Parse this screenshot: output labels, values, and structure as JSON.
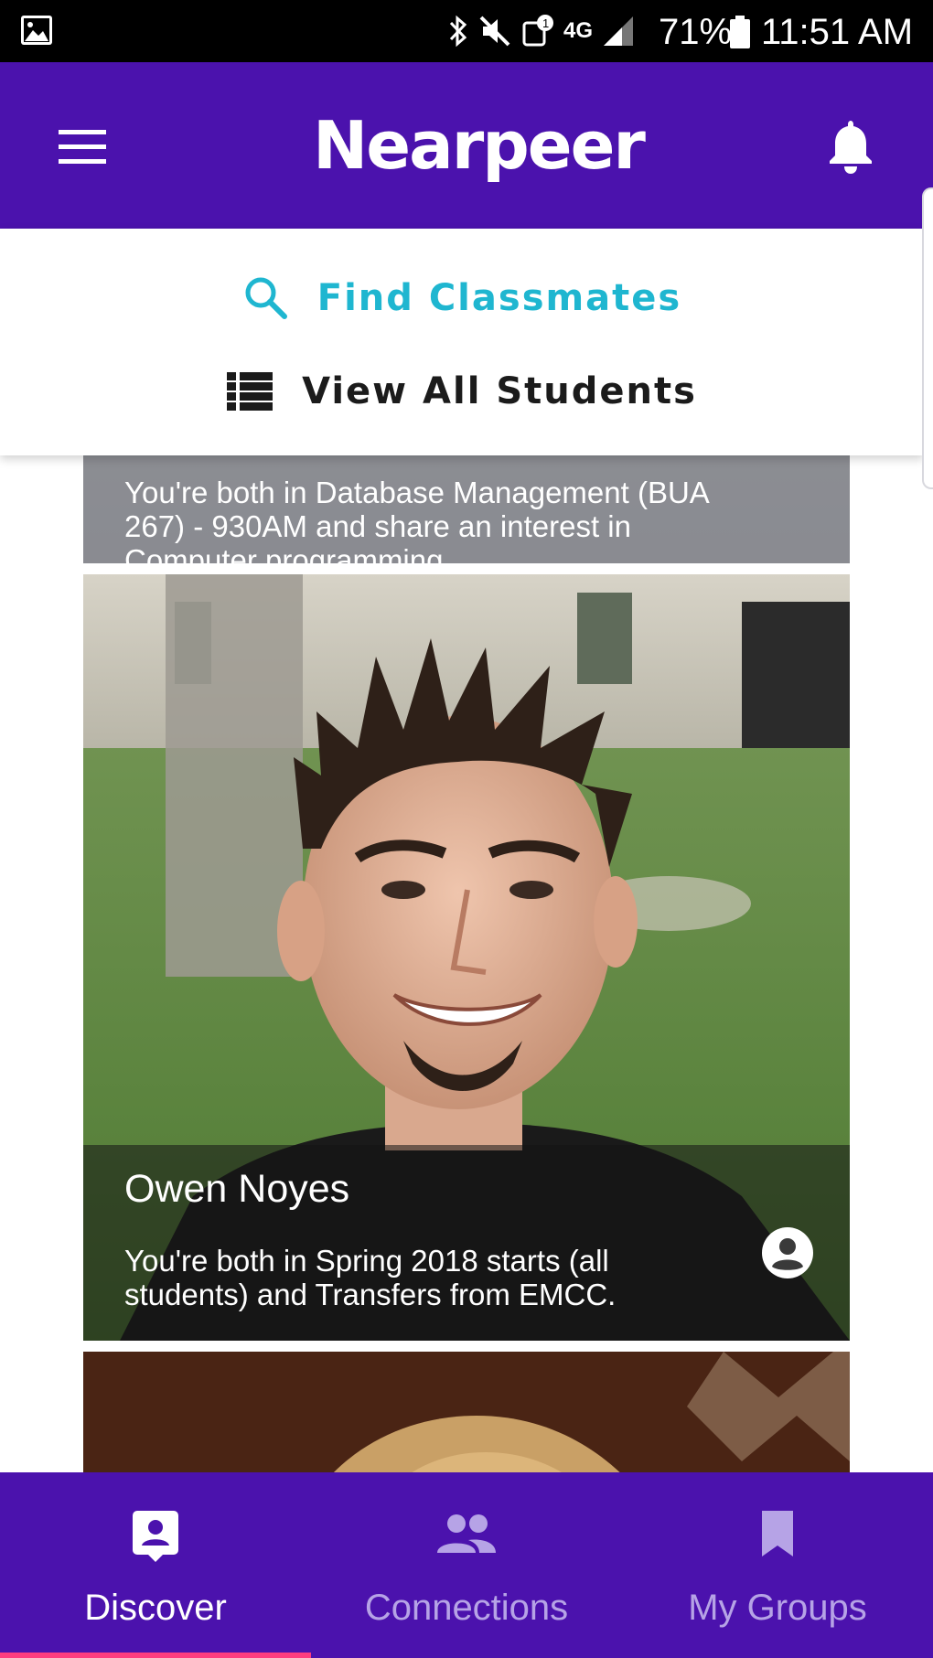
{
  "status_bar": {
    "battery_percent": "71%",
    "time": "11:51 AM",
    "network_label": "4G",
    "icons": [
      "gallery-icon",
      "bluetooth-icon",
      "mute-icon",
      "alert-icon",
      "network-icon",
      "signal-icon",
      "battery-icon"
    ]
  },
  "app_bar": {
    "title": "Nearpeer",
    "menu_icon": "hamburger-menu-icon",
    "notification_icon": "bell-icon"
  },
  "dropdown": {
    "find_label": "Find Classmates",
    "find_icon": "search-icon",
    "view_all_label": "View All Students",
    "view_all_icon": "list-icon"
  },
  "cards": [
    {
      "description": "You're both in Database Management (BUA 267) - 930AM and share an interest in Computer programming."
    },
    {
      "name": "Owen Noyes",
      "description": "You're both in Spring 2018 starts (all students) and Transfers from EMCC."
    }
  ],
  "bottom_nav": {
    "tabs": [
      {
        "label": "Discover",
        "icon": "discover-icon",
        "active": true
      },
      {
        "label": "Connections",
        "icon": "people-icon",
        "active": false
      },
      {
        "label": "My Groups",
        "icon": "bookmark-icon",
        "active": false
      }
    ]
  },
  "colors": {
    "brand": "#4b12ad",
    "find_accent": "#1fb6d0",
    "active_indicator": "#ff3d7f",
    "inactive_tab": "#b6a3e6"
  }
}
